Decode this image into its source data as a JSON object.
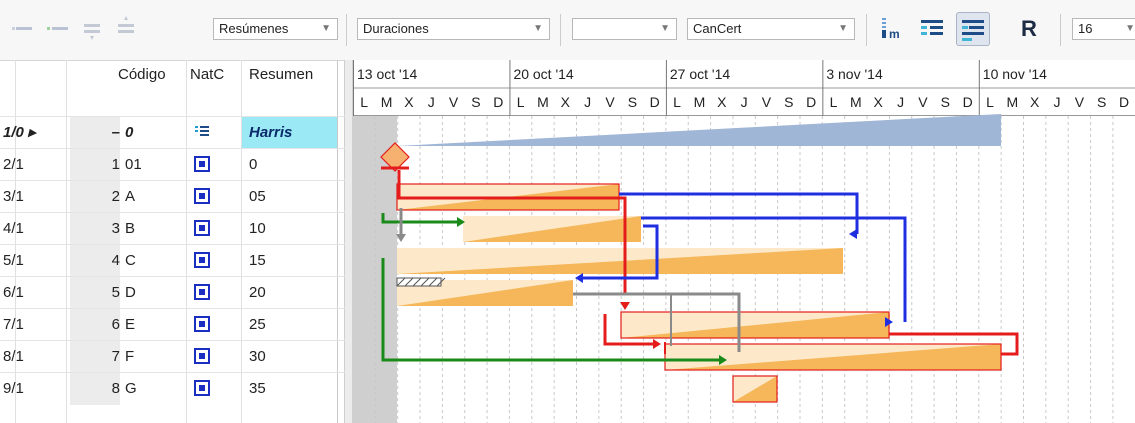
{
  "toolbar": {
    "icons": [
      "outdent-icon",
      "indent-icon",
      "move-down-icon",
      "move-up-icon"
    ],
    "combo_resumenes": "Resúmenes",
    "combo_duraciones": "Duraciones",
    "combo_empty": "",
    "combo_cancert": "CanCert",
    "toggle_icons": [
      "milestone-view-icon",
      "outline-view-icon",
      "gantt-view-icon",
      "resource-icon"
    ],
    "r_label": "R",
    "zoom_value": "16"
  },
  "columns": {
    "codigo": "Código",
    "natc": "NatC",
    "resumen": "Resumen"
  },
  "timeline": {
    "weeks": [
      "13 oct '14",
      "20 oct '14",
      "27 oct '14",
      "3 nov '14",
      "10 nov '14"
    ],
    "days": [
      "L",
      "M",
      "X",
      "J",
      "V",
      "S",
      "D"
    ]
  },
  "rows": [
    {
      "id": "1/0 ▸",
      "num": "–",
      "codigo": "0",
      "natc": "summary",
      "resumen": "Harris"
    },
    {
      "id": "2/1",
      "num": "1",
      "codigo": "01",
      "natc": "task",
      "resumen": "0"
    },
    {
      "id": "3/1",
      "num": "2",
      "codigo": "A",
      "natc": "task",
      "resumen": "05"
    },
    {
      "id": "4/1",
      "num": "3",
      "codigo": "B",
      "natc": "task",
      "resumen": "10"
    },
    {
      "id": "5/1",
      "num": "4",
      "codigo": "C",
      "natc": "task",
      "resumen": "15"
    },
    {
      "id": "6/1",
      "num": "5",
      "codigo": "D",
      "natc": "task",
      "resumen": "20"
    },
    {
      "id": "7/1",
      "num": "6",
      "codigo": "E",
      "natc": "task",
      "resumen": "25"
    },
    {
      "id": "8/1",
      "num": "7",
      "codigo": "F",
      "natc": "task",
      "resumen": "30"
    },
    {
      "id": "9/1",
      "num": "8",
      "codigo": "G",
      "natc": "task",
      "resumen": "35"
    }
  ],
  "colors": {
    "summary_bar": "#9fb6d6",
    "task_fill": "#f5b75a",
    "task_light": "#fde9c9",
    "critical": "#e51c1c",
    "link_blue": "#1f2fe0",
    "link_green": "#1a8a1a",
    "link_gray": "#8a8a8a",
    "selected_row": "#9be9f4"
  }
}
